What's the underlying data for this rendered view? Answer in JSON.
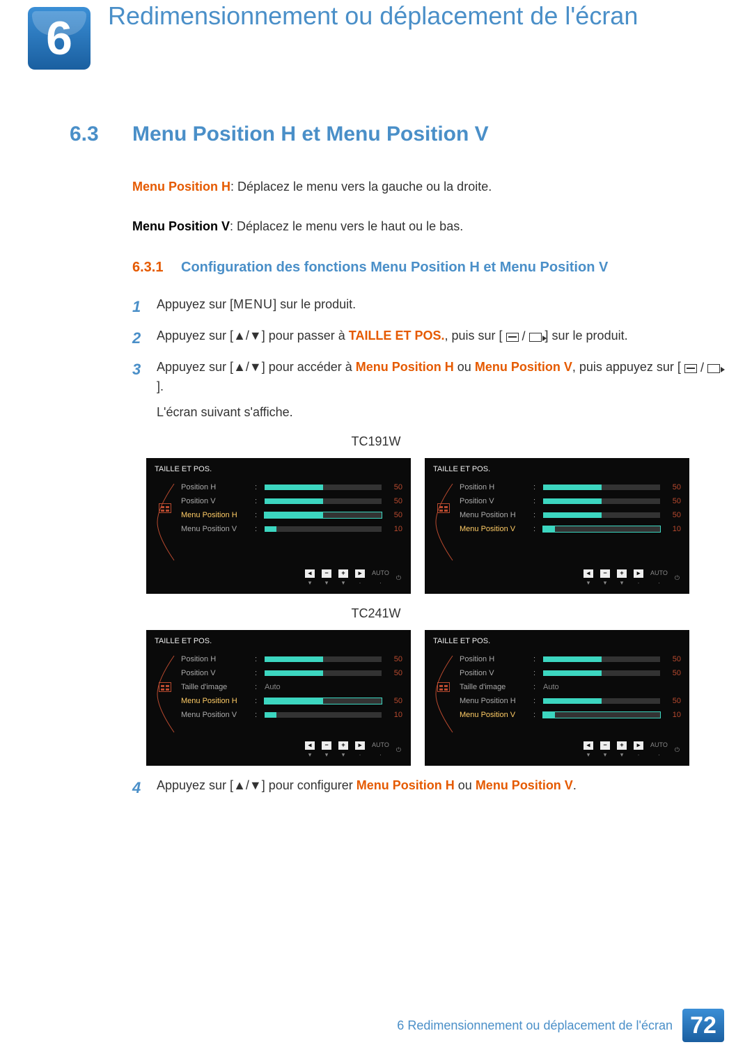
{
  "chapter": {
    "number": "6",
    "title": "Redimensionnement ou déplacement de l'écran"
  },
  "section": {
    "number": "6.3",
    "title": "Menu Position H et Menu Position V"
  },
  "intro": {
    "h_label": "Menu Position H",
    "h_desc": ": Déplacez le menu vers la gauche ou la droite.",
    "v_label": "Menu Position V",
    "v_desc": ": Déplacez le menu vers le haut ou le bas."
  },
  "subsection": {
    "number": "6.3.1",
    "title": "Configuration des fonctions Menu Position H et Menu Position V"
  },
  "steps": {
    "s1": {
      "n": "1",
      "t1": "Appuyez sur [",
      "menu": "MENU",
      "t2": "] sur le produit."
    },
    "s2": {
      "n": "2",
      "t1": "Appuyez sur [",
      "arrows": "▲/▼",
      "t2": "] pour passer à ",
      "tgt": "TAILLE ET POS.",
      "t3": ", puis sur [",
      "t4": "] sur le produit."
    },
    "s3": {
      "n": "3",
      "t1": "Appuyez sur [",
      "arrows": "▲/▼",
      "t2": "] pour accéder à ",
      "tgtA": "Menu Position H",
      "or": " ou ",
      "tgtB": "Menu Position V",
      "t3": ", puis appuyez sur [",
      "t4": "].",
      "after": "L'écran suivant s'affiche."
    },
    "s4": {
      "n": "4",
      "t1": "Appuyez sur [",
      "arrows": "▲/▼",
      "t2": "] pour configurer ",
      "tgtA": "Menu Position H",
      "or": " ou ",
      "tgtB": "Menu Position V",
      "t3": "."
    }
  },
  "models": {
    "a": "TC191W",
    "b": "TC241W"
  },
  "osd": {
    "title": "TAILLE ET POS.",
    "labels": {
      "ph": "Position H",
      "pv": "Position V",
      "mph": "Menu Position H",
      "mpv": "Menu Position V",
      "ti": "Taille d'image",
      "auto": "Auto"
    },
    "tc191w_left": {
      "rows": [
        "ph",
        "pv",
        "mph",
        "mpv"
      ],
      "values": {
        "ph": "50",
        "pv": "50",
        "mph": "50",
        "mpv": "10"
      },
      "fills": {
        "ph": 50,
        "pv": 50,
        "mph": 50,
        "mpv": 10
      },
      "selected": "mph"
    },
    "tc191w_right": {
      "rows": [
        "ph",
        "pv",
        "mph",
        "mpv"
      ],
      "values": {
        "ph": "50",
        "pv": "50",
        "mph": "50",
        "mpv": "10"
      },
      "fills": {
        "ph": 50,
        "pv": 50,
        "mph": 50,
        "mpv": 10
      },
      "selected": "mpv"
    },
    "tc241w_left": {
      "rows": [
        "ph",
        "pv",
        "ti",
        "mph",
        "mpv"
      ],
      "values": {
        "ph": "50",
        "pv": "50",
        "ti": "Auto",
        "mph": "50",
        "mpv": "10"
      },
      "fills": {
        "ph": 50,
        "pv": 50,
        "mph": 50,
        "mpv": 10
      },
      "selected": "mph"
    },
    "tc241w_right": {
      "rows": [
        "ph",
        "pv",
        "ti",
        "mph",
        "mpv"
      ],
      "values": {
        "ph": "50",
        "pv": "50",
        "ti": "Auto",
        "mph": "50",
        "mpv": "10"
      },
      "fills": {
        "ph": 50,
        "pv": 50,
        "mph": 50,
        "mpv": 10
      },
      "selected": "mpv"
    },
    "nav": {
      "auto": "AUTO"
    }
  },
  "footer": {
    "chapter_ref_num": "6",
    "chapter_ref_title": "Redimensionnement ou déplacement de l'écran",
    "page": "72"
  }
}
